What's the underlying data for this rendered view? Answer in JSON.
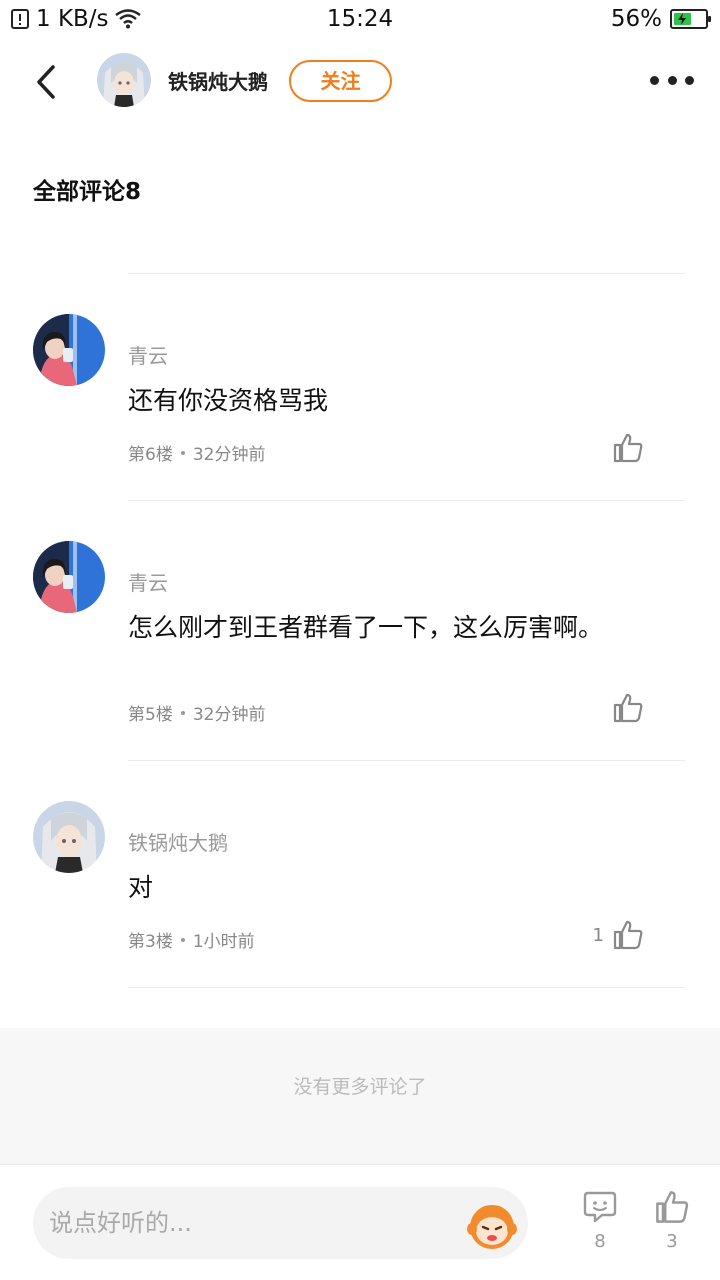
{
  "status_bar": {
    "network_speed": "1 KB/s",
    "time": "15:24",
    "battery_percent": "56%",
    "battery_level": 0.56
  },
  "header": {
    "author_name": "铁锅炖大鹅",
    "follow_label": "关注"
  },
  "section_title": "全部评论8",
  "comments": [
    {
      "user": "青云",
      "text": "还有你没资格骂我",
      "floor": "第6楼",
      "time": "32分钟前",
      "likes": ""
    },
    {
      "user": "青云",
      "text": "怎么刚才到王者群看了一下，这么厉害啊。",
      "floor": "第5楼",
      "time": "32分钟前",
      "likes": ""
    },
    {
      "user": "铁锅炖大鹅",
      "text": "对",
      "floor": "第3楼",
      "time": "1小时前",
      "likes": "1"
    }
  ],
  "no_more_text": "没有更多评论了",
  "bottom_bar": {
    "input_placeholder": "说点好听的...",
    "comment_count": "8",
    "like_count": "3"
  },
  "colors": {
    "accent": "#f07d1a",
    "battery": "#2ec24a"
  }
}
